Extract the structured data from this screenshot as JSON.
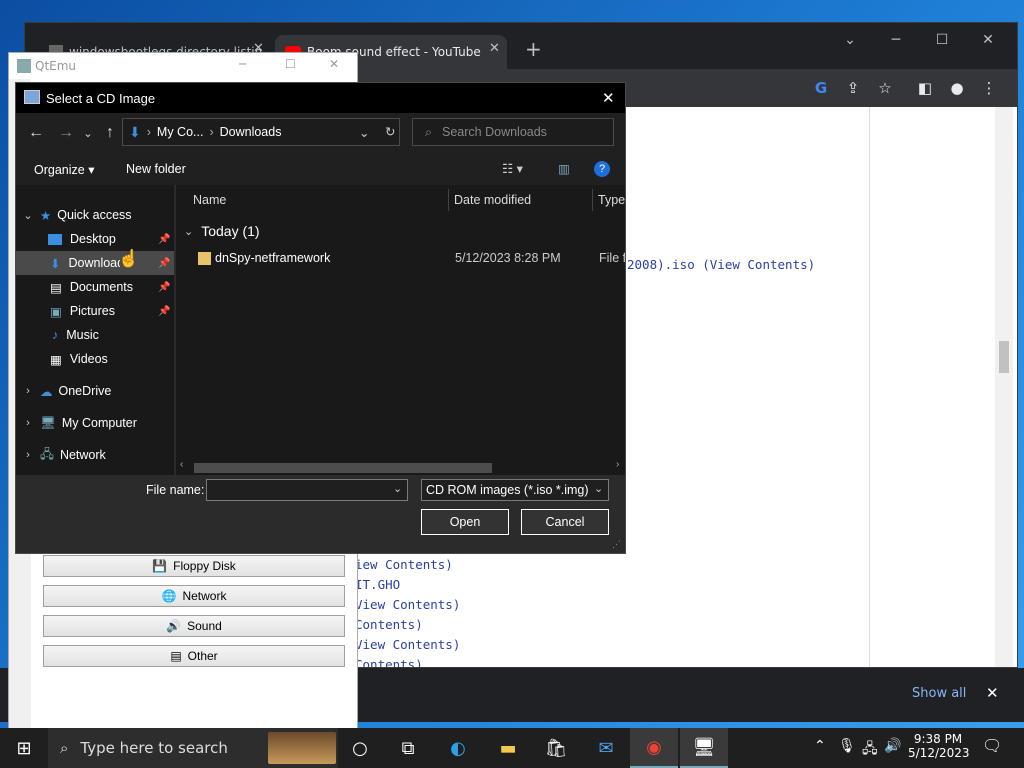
{
  "chrome": {
    "tabs": [
      {
        "label": "windowsbootlegs directory listin"
      },
      {
        "label": "Boom sound effect - YouTube"
      }
    ],
    "lines": [
      {
        "text": "2008).iso (View Contents)"
      },
      {
        "text": "iew Contents)"
      },
      {
        "text": "IT.GHO"
      },
      {
        "text": "View Contents)"
      },
      {
        "text": "Contents)"
      },
      {
        "text": "View Contents)"
      },
      {
        "text": "Contents)"
      }
    ],
    "show_all": "Show all",
    "icons": {
      "new_tab": "plus-icon",
      "close": "close-icon"
    }
  },
  "qtemu": {
    "title": "QtEmu",
    "buttons": [
      {
        "label": "Floppy Disk",
        "icon": "floppy-icon"
      },
      {
        "label": "Network",
        "icon": "globe-icon"
      },
      {
        "label": "Sound",
        "icon": "sound-icon"
      },
      {
        "label": "Other",
        "icon": "other-icon"
      }
    ]
  },
  "dialog": {
    "title": "Select a CD Image",
    "breadcrumb": [
      "My Co...",
      "Downloads"
    ],
    "search_placeholder": "Search Downloads",
    "organize": "Organize",
    "new_folder": "New folder",
    "tree": [
      {
        "label": "Quick access",
        "level": 0
      },
      {
        "label": "Desktop",
        "level": 1
      },
      {
        "label": "Downloads",
        "level": 1
      },
      {
        "label": "Documents",
        "level": 1
      },
      {
        "label": "Pictures",
        "level": 1
      },
      {
        "label": "Music",
        "level": 1
      },
      {
        "label": "Videos",
        "level": 1
      },
      {
        "label": "OneDrive",
        "level": 0
      },
      {
        "label": "My Computer",
        "level": 0
      },
      {
        "label": "Network",
        "level": 0
      }
    ],
    "columns": {
      "name": "Name",
      "date": "Date modified",
      "type": "Type"
    },
    "group": "Today (1)",
    "files": [
      {
        "name": "dnSpy-netframework",
        "date": "5/12/2023 8:28 PM",
        "type": "File fo"
      }
    ],
    "file_name_label": "File name:",
    "file_name_value": "",
    "filter": "CD ROM images (*.iso *.img)",
    "open": "Open",
    "cancel": "Cancel"
  },
  "taskbar": {
    "search_placeholder": "Type here to search",
    "time": "9:38 PM",
    "date": "5/12/2023"
  },
  "colors": {
    "accent": "#0078d7",
    "dialog_bg": "#202020",
    "taskbar": "#1f1f1f"
  }
}
